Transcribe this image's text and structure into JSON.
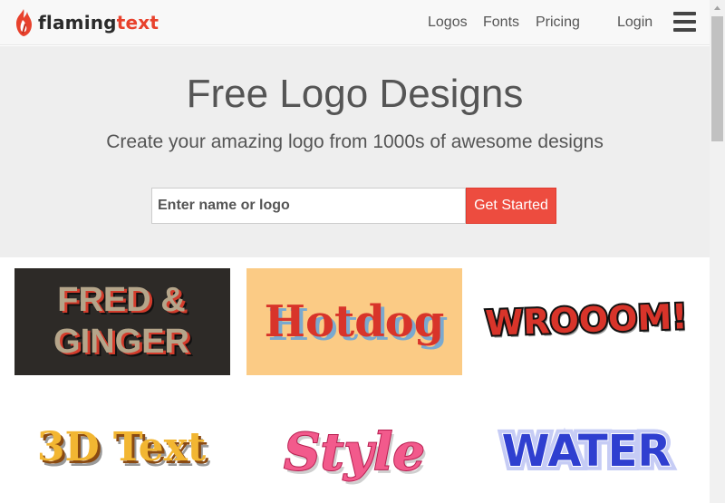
{
  "navbar": {
    "brand": {
      "part1": "flaming",
      "part2": "text"
    },
    "links": [
      "Logos",
      "Fonts",
      "Pricing"
    ],
    "login": "Login"
  },
  "hero": {
    "title": "Free Logo Designs",
    "subtitle": "Create your amazing logo from 1000s of awesome designs",
    "search_placeholder": "Enter name or logo",
    "search_value": "",
    "button": "Get Started"
  },
  "logos": [
    {
      "text_line1": "FRED &",
      "text_line2": "GINGER",
      "background": "#2d2a27"
    },
    {
      "text": "Hotdog",
      "background": "#fbcb85"
    },
    {
      "text": "WROOOM!",
      "background": "#ffffff"
    },
    {
      "text": "3D Text",
      "background": "#ffffff"
    },
    {
      "text": "Style",
      "background": "#ffffff"
    },
    {
      "text": "WATER",
      "background": "#ffffff"
    }
  ],
  "colors": {
    "accent": "#ed4c3f",
    "hero_bg": "#eeeeee",
    "navbar_bg": "#f8f8f8"
  }
}
